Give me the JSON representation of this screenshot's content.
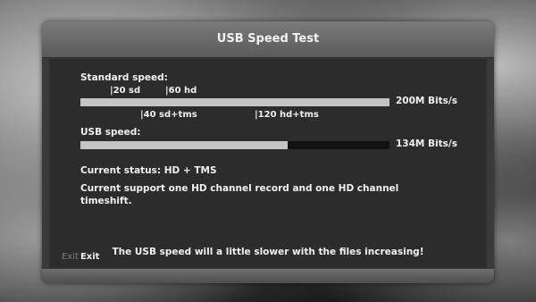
{
  "dialog": {
    "title": "USB Speed Test",
    "standard_speed_label": "Standard speed:",
    "standard_markers": {
      "sd": "|20 sd",
      "hd": "|60 hd",
      "sd_tms": "|40 sd+tms",
      "hd_tms": "|120 hd+tms"
    },
    "standard_bar_fill_fraction": 1.0,
    "standard_speed_value": "200M Bits/s",
    "usb_speed_label": "USB speed:",
    "usb_bar_fill_fraction": 0.67,
    "usb_speed_value": "134M Bits/s",
    "current_status": "Current status: HD + TMS",
    "support_line1": "Current support one HD channel record and one HD channel",
    "support_line2": "timeshift.",
    "note": "The USB speed will a little slower with the files increasing!",
    "exit_hint_dim": "Exit",
    "exit_label": "Exit"
  },
  "colors": {
    "panel": "#3a3a3a",
    "body": "#2c2c2c",
    "bar_track": "#121212",
    "bar_fill": "#c4c4c4",
    "text": "#f0f0f0"
  }
}
